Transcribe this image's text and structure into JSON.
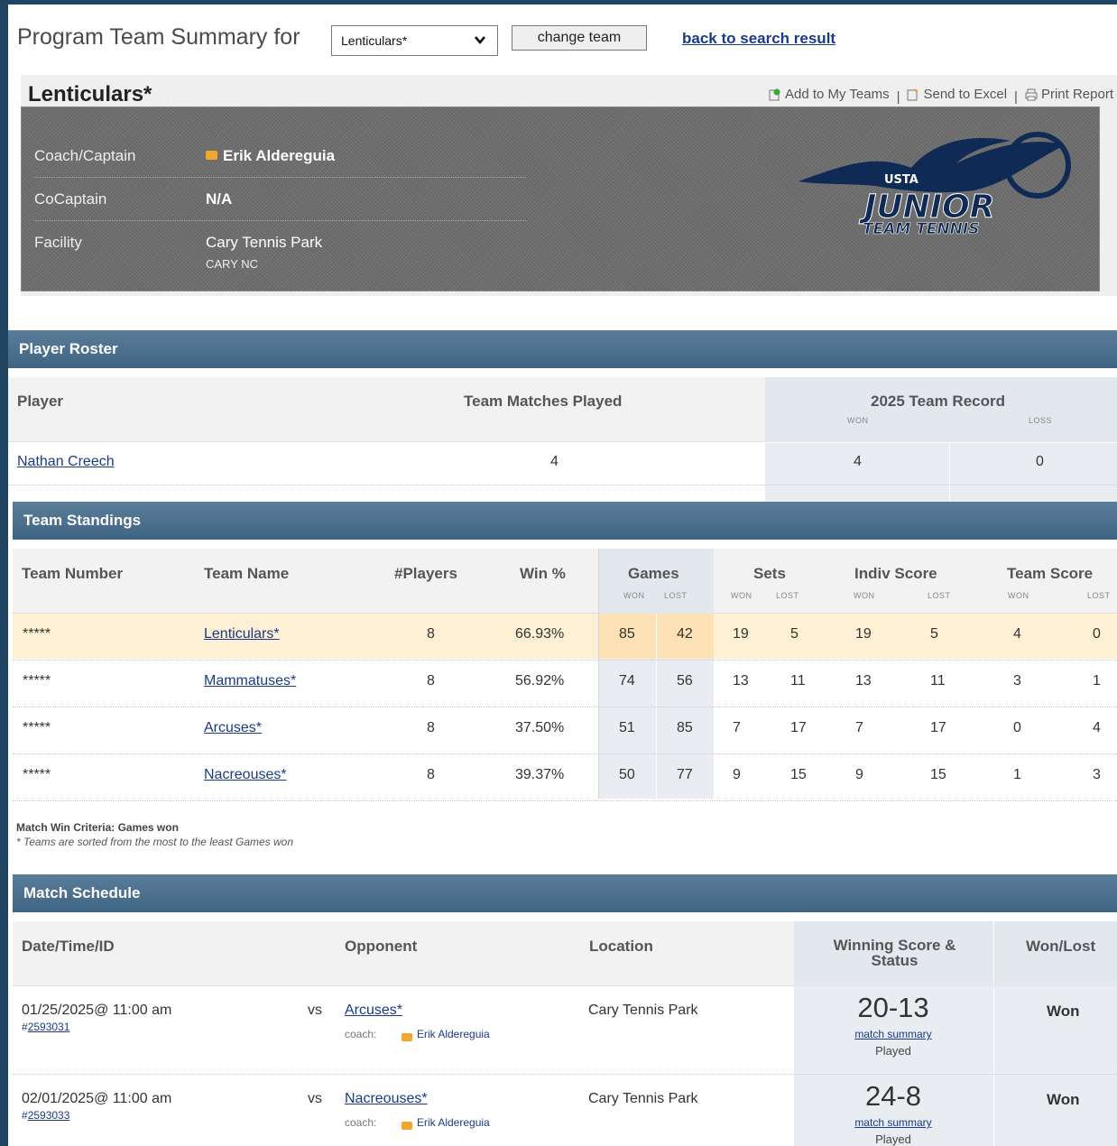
{
  "header": {
    "title": "Program Team Summary for",
    "team_select_value": "Lenticulars*",
    "change_team_label": "change team",
    "back_link_label": "back to search result"
  },
  "team": {
    "name": "Lenticulars*",
    "actions": {
      "add": "Add to My Teams",
      "excel": "Send to Excel",
      "print": "Print Report"
    },
    "info": [
      {
        "label": "Coach/Captain",
        "value": "Erik Aldereguia",
        "has_mail": true
      },
      {
        "label": "CoCaptain",
        "value": "N/A"
      },
      {
        "label": "Facility",
        "value": "Cary Tennis Park",
        "sub": "CARY NC"
      }
    ],
    "logo": {
      "top": "USTA",
      "main": "JUNIOR",
      "sub": "TEAM TENNIS",
      "color": "#0f2a55"
    }
  },
  "roster": {
    "title": "Player Roster",
    "columns": {
      "player": "Player",
      "played": "Team Matches Played",
      "record": "2025 Team Record",
      "won": "WON",
      "loss": "LOSS"
    },
    "rows": [
      {
        "player": "Nathan Creech",
        "played": "4",
        "won": "4",
        "loss": "0"
      }
    ]
  },
  "standings": {
    "title": "Team Standings",
    "columns": {
      "team_number": "Team Number",
      "team_name": "Team Name",
      "players": "#Players",
      "win_pct": "Win %",
      "games": "Games",
      "sets": "Sets",
      "indiv": "Indiv Score",
      "team_score": "Team Score",
      "won": "WON",
      "lost": "LOST"
    },
    "rows": [
      {
        "num": "*****",
        "name": "Lenticulars*",
        "players": "8",
        "pct": "66.93%",
        "gw": "85",
        "gl": "42",
        "sw": "19",
        "sl": "5",
        "iw": "19",
        "il": "5",
        "tw": "4",
        "tl": "0",
        "highlight": true
      },
      {
        "num": "*****",
        "name": "Mammatuses*",
        "players": "8",
        "pct": "56.92%",
        "gw": "74",
        "gl": "56",
        "sw": "13",
        "sl": "11",
        "iw": "13",
        "il": "11",
        "tw": "3",
        "tl": "1"
      },
      {
        "num": "*****",
        "name": "Arcuses*",
        "players": "8",
        "pct": "37.50%",
        "gw": "51",
        "gl": "85",
        "sw": "7",
        "sl": "17",
        "iw": "7",
        "il": "17",
        "tw": "0",
        "tl": "4"
      },
      {
        "num": "*****",
        "name": "Nacreouses*",
        "players": "8",
        "pct": "39.37%",
        "gw": "50",
        "gl": "77",
        "sw": "9",
        "sl": "15",
        "iw": "9",
        "il": "15",
        "tw": "1",
        "tl": "3"
      }
    ],
    "note_criteria": "Match Win Criteria: Games won",
    "note_sort": "* Teams are sorted from the most to the least Games won"
  },
  "schedule": {
    "title": "Match Schedule",
    "columns": {
      "date": "Date/Time/ID",
      "opponent": "Opponent",
      "location": "Location",
      "score": "Winning Score & Status",
      "wonlost": "Won/Lost"
    },
    "rows": [
      {
        "date": "01/25/2025@ 11:00 am",
        "id_prefix": "#",
        "id": "2593031",
        "vs": "vs",
        "opponent": "Arcuses*",
        "coach_label": "coach:",
        "coach": "Erik Aldereguia",
        "location": "Cary Tennis Park",
        "score": "20-13",
        "summary": "match summary",
        "status": "Played",
        "result": "Won"
      },
      {
        "date": "02/01/2025@ 11:00 am",
        "id_prefix": "#",
        "id": "2593033",
        "vs": "vs",
        "opponent": "Nacreouses*",
        "coach_label": "coach:",
        "coach": "Erik Aldereguia",
        "location": "Cary Tennis Park",
        "score": "24-8",
        "summary": "match summary",
        "status": "Played",
        "result": "Won"
      }
    ]
  },
  "colors": {
    "frame": "#1f4563",
    "section": "#4a6f8e",
    "highlight": "#fdf0d5",
    "link": "#1a3a8a"
  }
}
